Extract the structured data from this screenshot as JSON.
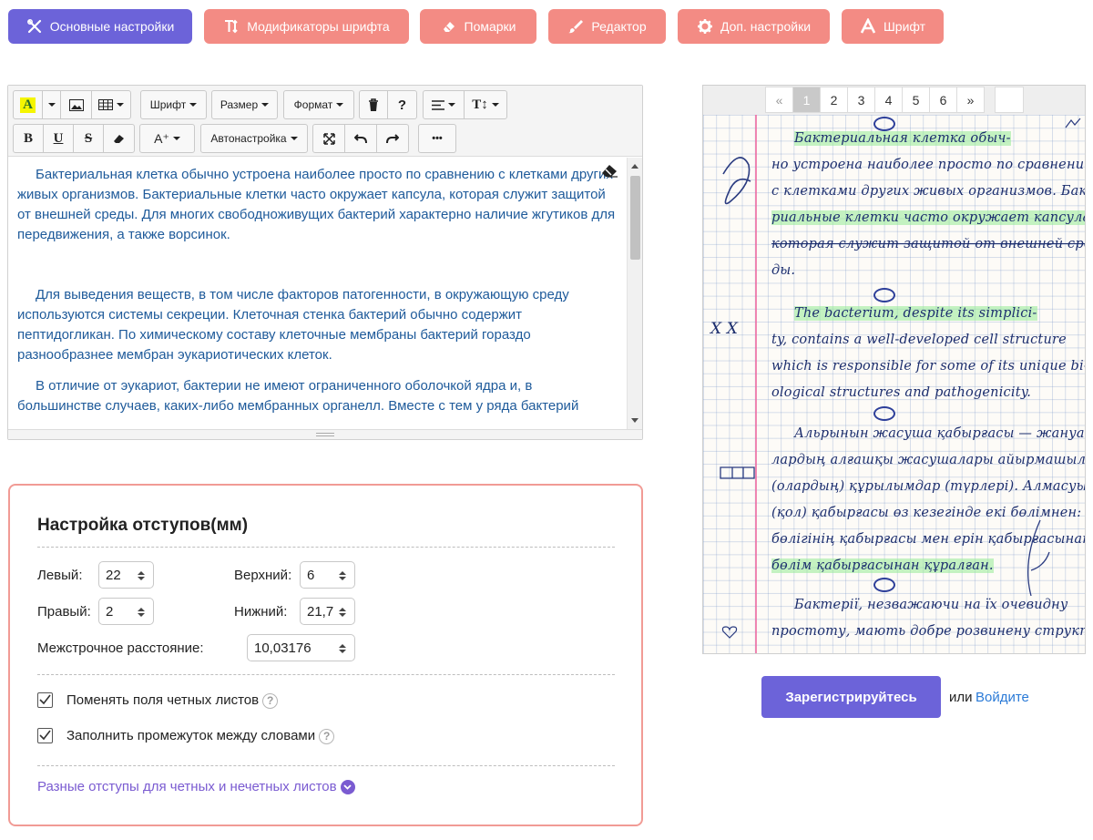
{
  "tabs": [
    {
      "label": "Основные настройки",
      "icon": "tools-icon"
    },
    {
      "label": "Модификаторы шрифта",
      "icon": "text-height-icon"
    },
    {
      "label": "Помарки",
      "icon": "eraser-icon"
    },
    {
      "label": "Редактор",
      "icon": "brush-icon"
    },
    {
      "label": "Доп. настройки",
      "icon": "gear-icon"
    },
    {
      "label": "Шрифт",
      "icon": "letter-a-icon"
    }
  ],
  "toolbar": {
    "font": "Шрифт",
    "size": "Размер",
    "format": "Формат",
    "autosetup": "Автонастройка",
    "bold": "B",
    "underline": "U",
    "strike": "S",
    "help": "?",
    "more": "•••",
    "text_size": "T↕",
    "grow_font": "A⁺"
  },
  "editor": {
    "paragraphs": [
      "Бактериальная клетка обычно устроена наиболее просто по сравнению с клетками других живых организмов. Бактериальные клетки часто окружает капсула, которая служит защитой от внешней среды. Для многих свободноживущих бактерий характерно наличие жгутиков для передвижения, а также ворсинок.",
      "Для выведения веществ, в том числе факторов патогенности, в окружающую среду используются системы секреции. Клеточная стенка бактерий обычно содержит пептидогликан. По химическому составу клеточные мембраны бактерий гораздо разнообразнее мембран эукариотических клеток.",
      "В отличие от эукариот, бактерии не имеют ограниченного оболочкой ядра и, в большинстве случаев, каких-либо мембранных органелл. Вместе с тем у ряда бактерий"
    ]
  },
  "margins": {
    "title": "Настройка отступов(мм)",
    "left_label": "Левый:",
    "left_value": "22",
    "top_label": "Верхний:",
    "top_value": "6",
    "right_label": "Правый:",
    "right_value": "2",
    "bottom_label": "Нижний:",
    "bottom_value": "21,7",
    "line_spacing_label": "Межстрочное расстояние:",
    "line_spacing_value": "10,03176",
    "swap_even_label": "Поменять поля четных листов",
    "swap_even_checked": true,
    "fill_gap_label": "Заполнить промежуток между словами",
    "fill_gap_checked": true,
    "help": "?",
    "diff_margins_link": "Разные отступы для четных и нечетных листов"
  },
  "preview": {
    "pager": [
      "«",
      "1",
      "2",
      "3",
      "4",
      "5",
      "6",
      "»"
    ],
    "active_page": "1",
    "lines": [
      "Бактериальная клетка обыч-",
      "но устроена наиболее просто по сравнению",
      "с клетками других живых организмов. Бакте-",
      "риальные клетки часто окружает капсула,",
      "которая служит защитой от внешней сре-",
      "ды.",
      "The bacterium, despite its simplici-",
      "ty, contains a well-developed cell structure",
      "which is responsible for some of its unique bi-",
      "ological structures and pathogenicity.",
      "Альрынын жасуша қабырғасы — жануар-",
      "лардың алғашқы жасушалары айырмашылығы",
      "(олардың) құрылымдар (түрлері). Алмасуы жасуша",
      "(қол) қабырғасы өз кезегінде екі бөлімнен: ішк",
      "бөлігінің қабырғасы мен ерін қабырғасынан",
      "бөлім қабырғасынан құралған.",
      "Бактерії, незважаючи на їх очевидну",
      "простоту, мають добре розвинену структу-"
    ]
  },
  "auth": {
    "register": "Зарегистрируйтесь",
    "or": "или",
    "login": "Войдите"
  },
  "colors": {
    "primary": "#6c63d9",
    "tab_inactive": "#f38b84",
    "editor_text": "#1e5a9a",
    "panel_border": "#f19b95",
    "ink": "#1c2e6e",
    "link": "#2a7ad7"
  }
}
